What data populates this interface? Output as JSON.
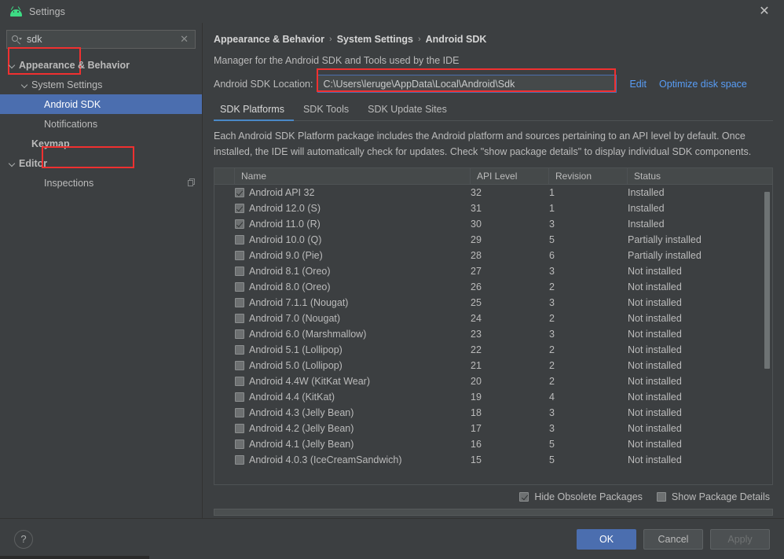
{
  "window": {
    "title": "Settings",
    "app_icon": "android-robot-icon",
    "close_icon": "close-icon"
  },
  "sidebar": {
    "search": {
      "value": "sdk",
      "placeholder": "",
      "search_icon": "search-icon",
      "clear_icon": "clear-icon"
    },
    "items": [
      {
        "label": "Appearance & Behavior",
        "indent": 0,
        "bold": true,
        "chevron": true,
        "selected": false,
        "icon": null
      },
      {
        "label": "System Settings",
        "indent": 1,
        "bold": false,
        "chevron": true,
        "selected": false,
        "icon": null
      },
      {
        "label": "Android SDK",
        "indent": 2,
        "bold": false,
        "chevron": false,
        "selected": true,
        "icon": null
      },
      {
        "label": "Notifications",
        "indent": 2,
        "bold": false,
        "chevron": false,
        "selected": false,
        "icon": null
      },
      {
        "label": "Keymap",
        "indent": 0,
        "bold": true,
        "chevron": false,
        "selected": false,
        "icon": null
      },
      {
        "label": "Editor",
        "indent": 0,
        "bold": true,
        "chevron": true,
        "selected": false,
        "icon": null
      },
      {
        "label": "Inspections",
        "indent": 1,
        "bold": false,
        "chevron": false,
        "selected": false,
        "icon": "copy-icon"
      }
    ]
  },
  "main": {
    "breadcrumb": [
      "Appearance & Behavior",
      "System Settings",
      "Android SDK"
    ],
    "breadcrumb_separator": "›",
    "manager_text": "Manager for the Android SDK and Tools used by the IDE",
    "location_label": "Android SDK Location:",
    "location_value": "C:\\Users\\leruge\\AppData\\Local\\Android\\Sdk",
    "edit_link": "Edit",
    "optimize_link": "Optimize disk space",
    "tabs": [
      {
        "label": "SDK Platforms",
        "active": true
      },
      {
        "label": "SDK Tools",
        "active": false
      },
      {
        "label": "SDK Update Sites",
        "active": false
      }
    ],
    "description": "Each Android SDK Platform package includes the Android platform and sources pertaining to an API level by default. Once installed, the IDE will automatically check for updates. Check \"show package details\" to display individual SDK components.",
    "table": {
      "columns": [
        "Name",
        "API Level",
        "Revision",
        "Status"
      ],
      "rows": [
        {
          "checked": true,
          "name": "Android API 32",
          "api": "32",
          "revision": "1",
          "status": "Installed"
        },
        {
          "checked": true,
          "name": "Android 12.0 (S)",
          "api": "31",
          "revision": "1",
          "status": "Installed"
        },
        {
          "checked": true,
          "name": "Android 11.0 (R)",
          "api": "30",
          "revision": "3",
          "status": "Installed"
        },
        {
          "checked": false,
          "name": "Android 10.0 (Q)",
          "api": "29",
          "revision": "5",
          "status": "Partially installed"
        },
        {
          "checked": false,
          "name": "Android 9.0 (Pie)",
          "api": "28",
          "revision": "6",
          "status": "Partially installed"
        },
        {
          "checked": false,
          "name": "Android 8.1 (Oreo)",
          "api": "27",
          "revision": "3",
          "status": "Not installed"
        },
        {
          "checked": false,
          "name": "Android 8.0 (Oreo)",
          "api": "26",
          "revision": "2",
          "status": "Not installed"
        },
        {
          "checked": false,
          "name": "Android 7.1.1 (Nougat)",
          "api": "25",
          "revision": "3",
          "status": "Not installed"
        },
        {
          "checked": false,
          "name": "Android 7.0 (Nougat)",
          "api": "24",
          "revision": "2",
          "status": "Not installed"
        },
        {
          "checked": false,
          "name": "Android 6.0 (Marshmallow)",
          "api": "23",
          "revision": "3",
          "status": "Not installed"
        },
        {
          "checked": false,
          "name": "Android 5.1 (Lollipop)",
          "api": "22",
          "revision": "2",
          "status": "Not installed"
        },
        {
          "checked": false,
          "name": "Android 5.0 (Lollipop)",
          "api": "21",
          "revision": "2",
          "status": "Not installed"
        },
        {
          "checked": false,
          "name": "Android 4.4W (KitKat Wear)",
          "api": "20",
          "revision": "2",
          "status": "Not installed"
        },
        {
          "checked": false,
          "name": "Android 4.4 (KitKat)",
          "api": "19",
          "revision": "4",
          "status": "Not installed"
        },
        {
          "checked": false,
          "name": "Android 4.3 (Jelly Bean)",
          "api": "18",
          "revision": "3",
          "status": "Not installed"
        },
        {
          "checked": false,
          "name": "Android 4.2 (Jelly Bean)",
          "api": "17",
          "revision": "3",
          "status": "Not installed"
        },
        {
          "checked": false,
          "name": "Android 4.1 (Jelly Bean)",
          "api": "16",
          "revision": "5",
          "status": "Not installed"
        },
        {
          "checked": false,
          "name": "Android 4.0.3 (IceCreamSandwich)",
          "api": "15",
          "revision": "5",
          "status": "Not installed"
        }
      ]
    },
    "options": [
      {
        "label": "Hide Obsolete Packages",
        "checked": true
      },
      {
        "label": "Show Package Details",
        "checked": false
      }
    ]
  },
  "footer": {
    "help_label": "?",
    "buttons": [
      {
        "label": "OK",
        "style": "primary"
      },
      {
        "label": "Cancel",
        "style": "normal"
      },
      {
        "label": "Apply",
        "style": "disabled"
      }
    ]
  },
  "colors": {
    "accent": "#4b6eaf",
    "link": "#589df6",
    "annotation": "#f03030",
    "android_green": "#3ddc84",
    "background": "#3c3f41"
  }
}
